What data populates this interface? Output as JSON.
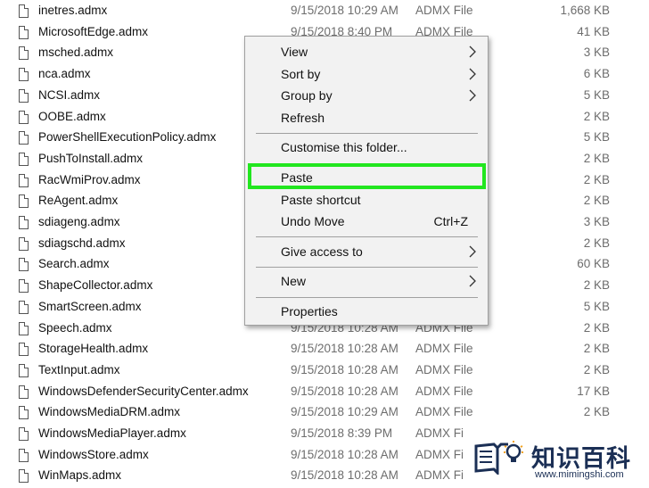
{
  "files": [
    {
      "name": "inetres.admx",
      "date": "9/15/2018 10:29 AM",
      "type": "ADMX File",
      "size": "1,668 KB"
    },
    {
      "name": "MicrosoftEdge.admx",
      "date": "9/15/2018 8:40 PM",
      "type": "ADMX File",
      "size": "41 KB"
    },
    {
      "name": "msched.admx",
      "date": "",
      "type": "",
      "size": "3 KB"
    },
    {
      "name": "nca.admx",
      "date": "",
      "type": "",
      "size": "6 KB"
    },
    {
      "name": "NCSI.admx",
      "date": "",
      "type": "",
      "size": "5 KB"
    },
    {
      "name": "OOBE.admx",
      "date": "",
      "type": "",
      "size": "2 KB"
    },
    {
      "name": "PowerShellExecutionPolicy.admx",
      "date": "",
      "type": "",
      "size": "5 KB"
    },
    {
      "name": "PushToInstall.admx",
      "date": "",
      "type": "",
      "size": "2 KB"
    },
    {
      "name": "RacWmiProv.admx",
      "date": "",
      "type": "",
      "size": "2 KB"
    },
    {
      "name": "ReAgent.admx",
      "date": "",
      "type": "",
      "size": "2 KB"
    },
    {
      "name": "sdiageng.admx",
      "date": "",
      "type": "",
      "size": "3 KB"
    },
    {
      "name": "sdiagschd.admx",
      "date": "",
      "type": "",
      "size": "2 KB"
    },
    {
      "name": "Search.admx",
      "date": "",
      "type": "",
      "size": "60 KB"
    },
    {
      "name": "ShapeCollector.admx",
      "date": "",
      "type": "",
      "size": "2 KB"
    },
    {
      "name": "SmartScreen.admx",
      "date": "",
      "type": "",
      "size": "5 KB"
    },
    {
      "name": "Speech.admx",
      "date": "9/15/2018 10:28 AM",
      "type": "ADMX File",
      "size": "2 KB"
    },
    {
      "name": "StorageHealth.admx",
      "date": "9/15/2018 10:28 AM",
      "type": "ADMX File",
      "size": "2 KB"
    },
    {
      "name": "TextInput.admx",
      "date": "9/15/2018 10:28 AM",
      "type": "ADMX File",
      "size": "2 KB"
    },
    {
      "name": "WindowsDefenderSecurityCenter.admx",
      "date": "9/15/2018 10:28 AM",
      "type": "ADMX File",
      "size": "17 KB"
    },
    {
      "name": "WindowsMediaDRM.admx",
      "date": "9/15/2018 10:29 AM",
      "type": "ADMX File",
      "size": "2 KB"
    },
    {
      "name": "WindowsMediaPlayer.admx",
      "date": "9/15/2018 8:39 PM",
      "type": "ADMX Fi",
      "size": ""
    },
    {
      "name": "WindowsStore.admx",
      "date": "9/15/2018 10:28 AM",
      "type": "ADMX Fi",
      "size": ""
    },
    {
      "name": "WinMaps.admx",
      "date": "9/15/2018 10:28 AM",
      "type": "ADMX Fi",
      "size": ""
    }
  ],
  "context_menu": {
    "groups": [
      [
        {
          "label": "View",
          "submenu": true
        },
        {
          "label": "Sort by",
          "submenu": true
        },
        {
          "label": "Group by",
          "submenu": true
        },
        {
          "label": "Refresh"
        }
      ],
      [
        {
          "label": "Customise this folder..."
        }
      ],
      [
        {
          "label": "Paste",
          "highlighted": true
        },
        {
          "label": "Paste shortcut"
        },
        {
          "label": "Undo Move",
          "shortcut": "Ctrl+Z"
        }
      ],
      [
        {
          "label": "Give access to",
          "submenu": true
        }
      ],
      [
        {
          "label": "New",
          "submenu": true
        }
      ],
      [
        {
          "label": "Properties"
        }
      ]
    ]
  },
  "highlight_color": "#22e61f",
  "watermark": {
    "title": "知识百科",
    "url": "www.mimingshi.com",
    "logo_icon": "book-lightbulb-icon",
    "color": "#1b2f55"
  }
}
